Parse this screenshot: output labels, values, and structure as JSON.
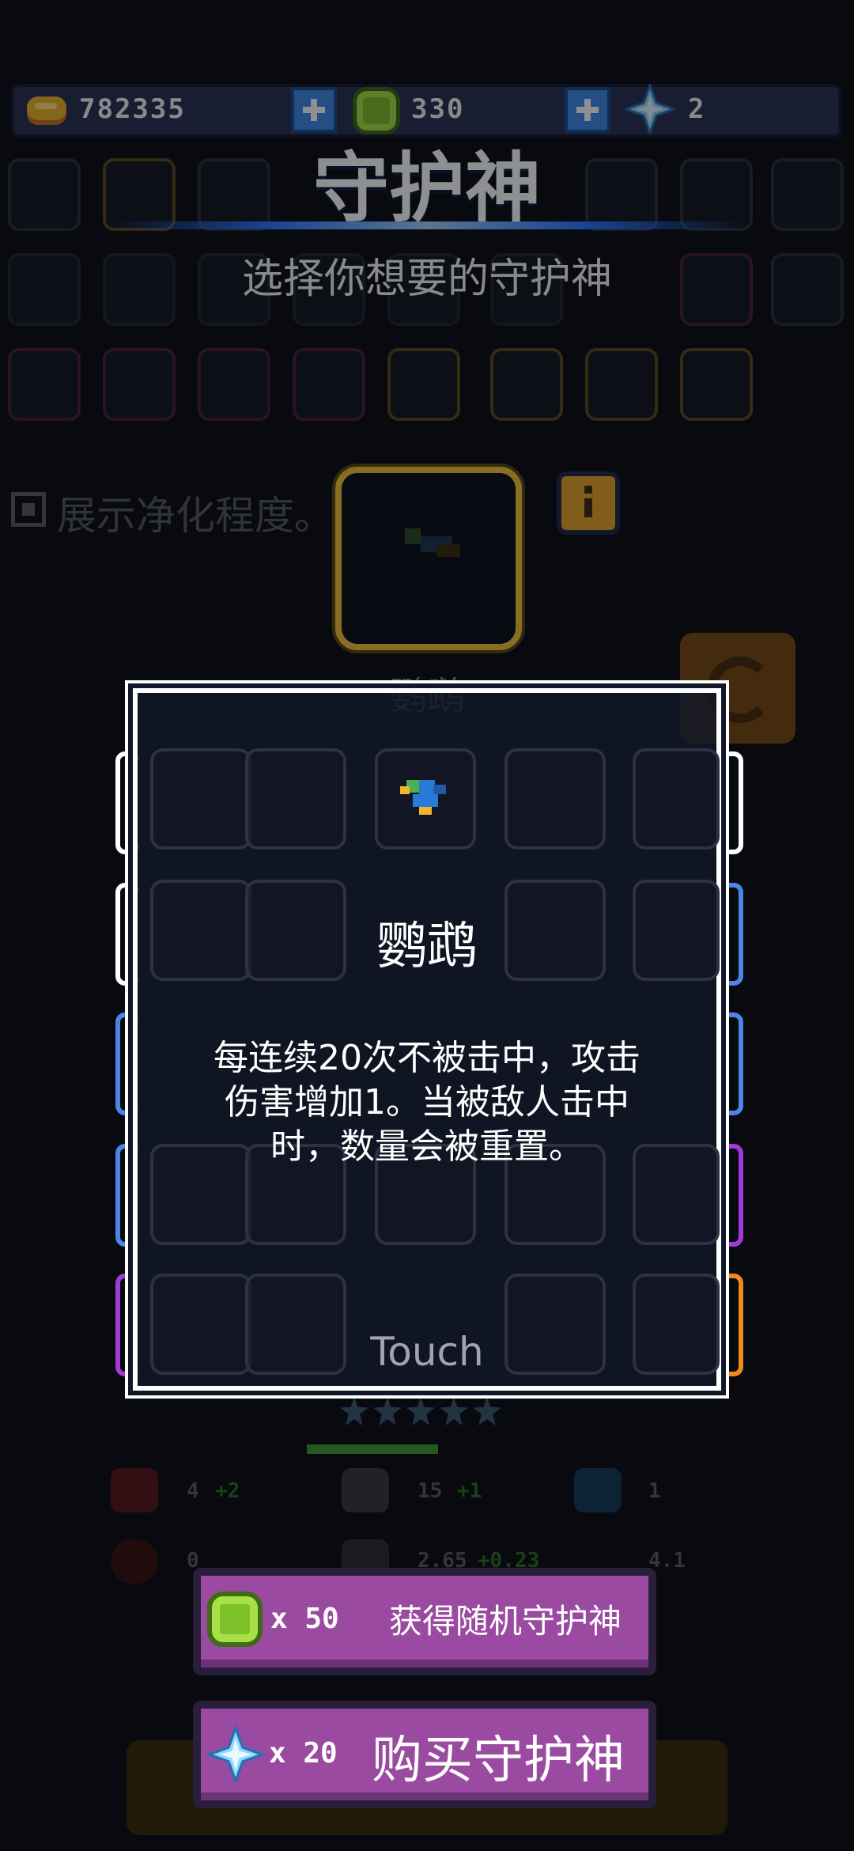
{
  "resources": {
    "gold": "782335",
    "gems": "330",
    "crystals": "2"
  },
  "header": {
    "title": "守护神",
    "subtitle": "选择你想要的守护神"
  },
  "toggle": {
    "label": "展示净化程度。"
  },
  "selected_pet": {
    "name": "鹦鹉"
  },
  "modal": {
    "name": "鹦鹉",
    "description_lines": [
      "每连续20次不被击中，攻击",
      "伤害增加1。当被敌人击中",
      "时，数量会被重置。"
    ],
    "dismiss_hint": "Touch"
  },
  "stats": {
    "hp": "4",
    "hp_bonus": "+2",
    "attack": "15",
    "attack_bonus": "+1",
    "shield": "1",
    "row2_a": "0",
    "row2_b": "2.65",
    "row2_b_bonus": "+0.23",
    "row2_c": "4.1"
  },
  "buttons": {
    "random": {
      "cost_prefix": "x",
      "cost": "50",
      "label": "获得随机守护神"
    },
    "buy": {
      "cost_prefix": "x",
      "cost": "20",
      "label": "购买守护神"
    }
  },
  "colors": {
    "accent_gold": "#f4c138",
    "button_purple": "#9a4aa0",
    "gem_green": "#7fc12a",
    "crystal_blue": "#8fd8ff"
  }
}
